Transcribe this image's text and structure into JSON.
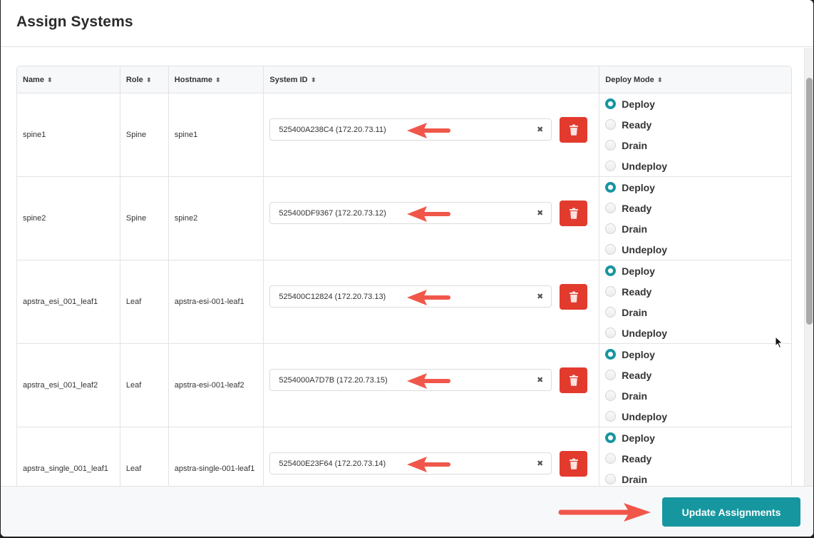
{
  "modal": {
    "title": "Assign Systems"
  },
  "table": {
    "columns": [
      {
        "label": "Name",
        "sort_icon": "sort-icon"
      },
      {
        "label": "Role",
        "sort_icon": "sort-icon"
      },
      {
        "label": "Hostname",
        "sort_icon": "sort-icon"
      },
      {
        "label": "System ID",
        "sort_icon": "sort-icon"
      },
      {
        "label": "Deploy Mode",
        "sort_icon": "sort-icon"
      }
    ],
    "deploy_modes": [
      "Deploy",
      "Ready",
      "Drain",
      "Undeploy"
    ],
    "rows": [
      {
        "name": "spine1",
        "role": "Spine",
        "hostname": "spine1",
        "system_id": "525400A238C4 (172.20.73.11)",
        "deploy_mode": "Deploy"
      },
      {
        "name": "spine2",
        "role": "Spine",
        "hostname": "spine2",
        "system_id": "525400DF9367 (172.20.73.12)",
        "deploy_mode": "Deploy"
      },
      {
        "name": "apstra_esi_001_leaf1",
        "role": "Leaf",
        "hostname": "apstra-esi-001-leaf1",
        "system_id": "525400C12824 (172.20.73.13)",
        "deploy_mode": "Deploy"
      },
      {
        "name": "apstra_esi_001_leaf2",
        "role": "Leaf",
        "hostname": "apstra-esi-001-leaf2",
        "system_id": "5254000A7D7B (172.20.73.15)",
        "deploy_mode": "Deploy"
      },
      {
        "name": "apstra_single_001_leaf1",
        "role": "Leaf",
        "hostname": "apstra-single-001-leaf1",
        "system_id": "525400E23F64 (172.20.73.14)",
        "deploy_mode": "Deploy"
      }
    ]
  },
  "footer": {
    "update_label": "Update Assignments"
  },
  "icons": {
    "sort": "⬍",
    "clear": "✖"
  },
  "colors": {
    "accent": "#16979f",
    "danger": "#e23b2e",
    "annotation_arrow": "#f0574a"
  }
}
